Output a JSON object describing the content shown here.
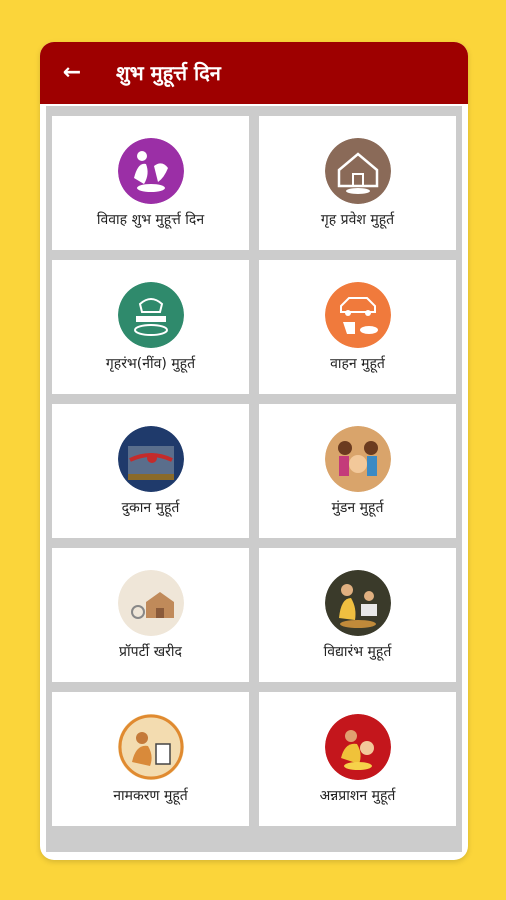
{
  "header": {
    "title": "शुभ मुहूर्त्त दिन",
    "back_icon": "arrow-left-icon"
  },
  "colors": {
    "background": "#fbd53a",
    "appbar": "#9e0000",
    "grid_bg": "#cccccc"
  },
  "items": [
    {
      "label": "विवाह शुभ मुहूर्त्त दिन",
      "icon": "wedding-icon",
      "color": "#9b2fa6"
    },
    {
      "label": "गृह प्रवेश मुहूर्त",
      "icon": "house-entry-icon",
      "color": "#8a6a58"
    },
    {
      "label": "गृहरंभ(नींव) मुहूर्त",
      "icon": "foundation-icon",
      "color": "#2f8a6c"
    },
    {
      "label": "वाहन मुहूर्त",
      "icon": "vehicle-icon",
      "color": "#f07a3c"
    },
    {
      "label": "दुकान  मुहूर्त",
      "icon": "shop-icon",
      "color": "#1f3a6b"
    },
    {
      "label": "मुंडन मुहूर्त",
      "icon": "mundan-icon",
      "color": "#d9a46b"
    },
    {
      "label": "प्रॉपर्टी खरीद",
      "icon": "property-icon",
      "color": "#efe6d8"
    },
    {
      "label": "विद्यारंभ मुहूर्त",
      "icon": "vidyarambh-icon",
      "color": "#3a3a2a"
    },
    {
      "label": "नामकरण मुहूर्त",
      "icon": "naming-icon",
      "color": "#e8a257"
    },
    {
      "label": "अन्नप्राशन मुहूर्त",
      "icon": "annaprashan-icon",
      "color": "#c4161c"
    }
  ]
}
